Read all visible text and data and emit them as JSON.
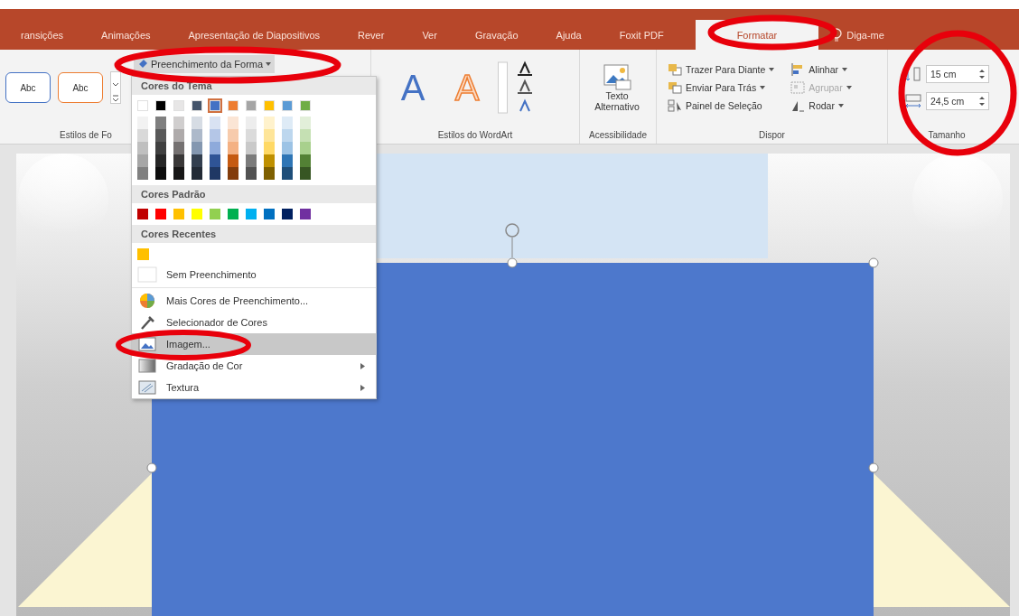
{
  "tabs": [
    {
      "label": "ransições",
      "selected": false
    },
    {
      "label": "Animações",
      "selected": false
    },
    {
      "label": "Apresentação de Diapositivos",
      "selected": false
    },
    {
      "label": "Rever",
      "selected": false
    },
    {
      "label": "Ver",
      "selected": false
    },
    {
      "label": "Gravação",
      "selected": false
    },
    {
      "label": "Ajuda",
      "selected": false
    },
    {
      "label": "Foxit PDF",
      "selected": false
    },
    {
      "label": "Formatar",
      "selected": true
    }
  ],
  "tell_me": {
    "label": "Diga-me"
  },
  "ribbon": {
    "shape_styles": {
      "samples": [
        {
          "text": "Abc",
          "color": "#4472c4"
        },
        {
          "text": "Abc",
          "color": "#ed7d31"
        }
      ],
      "fill_button": "Preenchimento da Forma",
      "label": "Estilos de Fo"
    },
    "wordart": {
      "samples": [
        {
          "text": "A",
          "kind": "filled"
        },
        {
          "text": "A",
          "kind": "outline"
        }
      ],
      "label": "Estilos do WordArt"
    },
    "accessibility": {
      "alt_text_button": "Texto Alternativo",
      "label": "Acessibilidade"
    },
    "arrange": {
      "columns": [
        [
          {
            "label": "Trazer Para Diante",
            "kind": "front",
            "disabled": false,
            "dropdown": true
          },
          {
            "label": "Enviar Para Trás",
            "kind": "back",
            "disabled": false,
            "dropdown": true
          },
          {
            "label": "Painel de Seleção",
            "kind": "pane",
            "disabled": false,
            "dropdown": false
          }
        ],
        [
          {
            "label": "Alinhar",
            "kind": "align",
            "disabled": false,
            "dropdown": true
          },
          {
            "label": "Agrupar",
            "kind": "group",
            "disabled": true,
            "dropdown": true
          },
          {
            "label": "Rodar",
            "kind": "rotate",
            "disabled": false,
            "dropdown": true
          }
        ]
      ],
      "label": "Dispor"
    },
    "size": {
      "height": "15 cm",
      "width": "24,5 cm",
      "label": "Tamanho"
    }
  },
  "fill_menu": {
    "theme_heading": "Cores do Tema",
    "theme_colors": [
      {
        "color": "#ffffff",
        "selected": false,
        "shades": [
          {
            "color": "#f2f2f2"
          },
          {
            "color": "#d9d9d9"
          },
          {
            "color": "#bfbfbf"
          },
          {
            "color": "#a6a6a6"
          },
          {
            "color": "#808080"
          }
        ]
      },
      {
        "color": "#000000",
        "selected": false,
        "shades": [
          {
            "color": "#7f7f7f"
          },
          {
            "color": "#595959"
          },
          {
            "color": "#404040"
          },
          {
            "color": "#262626"
          },
          {
            "color": "#0d0d0d"
          }
        ]
      },
      {
        "color": "#e7e6e6",
        "selected": false,
        "shades": [
          {
            "color": "#d0cece"
          },
          {
            "color": "#aeaaaa"
          },
          {
            "color": "#757171"
          },
          {
            "color": "#3a3838"
          },
          {
            "color": "#171616"
          }
        ]
      },
      {
        "color": "#44546a",
        "selected": false,
        "shades": [
          {
            "color": "#d6dce4"
          },
          {
            "color": "#adb9ca"
          },
          {
            "color": "#8497b0"
          },
          {
            "color": "#333f4f"
          },
          {
            "color": "#222a35"
          }
        ]
      },
      {
        "color": "#4472c4",
        "selected": true,
        "shades": [
          {
            "color": "#d9e2f3"
          },
          {
            "color": "#b4c6e7"
          },
          {
            "color": "#8eaadb"
          },
          {
            "color": "#2f5496"
          },
          {
            "color": "#1f3864"
          }
        ]
      },
      {
        "color": "#ed7d31",
        "selected": false,
        "shades": [
          {
            "color": "#fbe5d5"
          },
          {
            "color": "#f7cbac"
          },
          {
            "color": "#f4b183"
          },
          {
            "color": "#c55a11"
          },
          {
            "color": "#833c0b"
          }
        ]
      },
      {
        "color": "#a5a5a5",
        "selected": false,
        "shades": [
          {
            "color": "#ededed"
          },
          {
            "color": "#dbdbdb"
          },
          {
            "color": "#c9c9c9"
          },
          {
            "color": "#7b7b7b"
          },
          {
            "color": "#525252"
          }
        ]
      },
      {
        "color": "#ffc000",
        "selected": false,
        "shades": [
          {
            "color": "#fff2cc"
          },
          {
            "color": "#fee599"
          },
          {
            "color": "#ffd965"
          },
          {
            "color": "#bf9000"
          },
          {
            "color": "#7f6000"
          }
        ]
      },
      {
        "color": "#5b9bd5",
        "selected": false,
        "shades": [
          {
            "color": "#deebf6"
          },
          {
            "color": "#bdd7ee"
          },
          {
            "color": "#9cc3e5"
          },
          {
            "color": "#2e75b5"
          },
          {
            "color": "#1e4e79"
          }
        ]
      },
      {
        "color": "#70ad47",
        "selected": false,
        "shades": [
          {
            "color": "#e2efd9"
          },
          {
            "color": "#c5e0b3"
          },
          {
            "color": "#a8d08d"
          },
          {
            "color": "#538135"
          },
          {
            "color": "#375623"
          }
        ]
      }
    ],
    "standard_heading": "Cores Padrão",
    "standard_colors": [
      {
        "color": "#c00000"
      },
      {
        "color": "#ff0000"
      },
      {
        "color": "#ffc000"
      },
      {
        "color": "#ffff00"
      },
      {
        "color": "#92d050"
      },
      {
        "color": "#00b050"
      },
      {
        "color": "#00b0f0"
      },
      {
        "color": "#0070c0"
      },
      {
        "color": "#002060"
      },
      {
        "color": "#7030a0"
      }
    ],
    "recent_heading": "Cores Recentes",
    "recent_colors": [
      {
        "color": "#ffc000"
      }
    ],
    "items": [
      {
        "label": "Sem Preenchimento",
        "kind": "none",
        "selected": false,
        "submenu": false
      },
      {
        "label": "Mais Cores de Preenchimento...",
        "kind": "palette",
        "selected": false,
        "submenu": false
      },
      {
        "label": "Selecionador de Cores",
        "kind": "eyedropper",
        "selected": false,
        "submenu": false
      },
      {
        "label": "Imagem...",
        "kind": "picture",
        "selected": true,
        "submenu": false
      },
      {
        "label": "Gradação de Cor",
        "kind": "gradient",
        "selected": false,
        "submenu": true
      },
      {
        "label": "Textura",
        "kind": "texture",
        "selected": false,
        "submenu": true
      }
    ]
  }
}
